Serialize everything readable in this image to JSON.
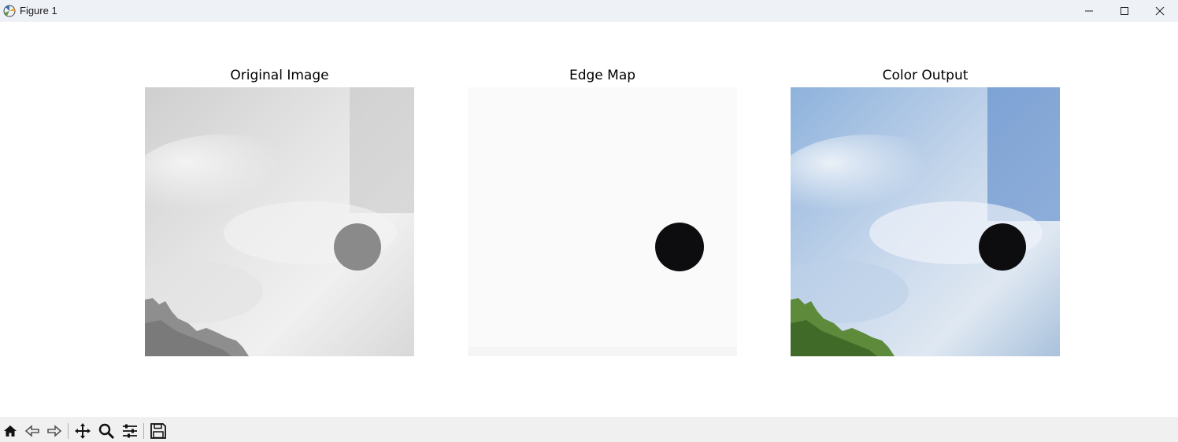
{
  "window": {
    "title": "Figure 1"
  },
  "figure": {
    "panels": [
      {
        "title": "Original Image"
      },
      {
        "title": "Edge Map"
      },
      {
        "title": "Color Output"
      }
    ]
  },
  "toolbar": {
    "buttons": [
      "home-icon",
      "back-icon",
      "forward-icon",
      "pan-icon",
      "zoom-icon",
      "configure-subplots-icon",
      "save-icon"
    ]
  },
  "colors": {
    "titlebar_bg": "#eef2f7",
    "toolbar_bg": "#f0f0f0",
    "sky_blue": "#4a7ec4",
    "grey_circle": "#8a8a8a",
    "dark_circle": "#0d0d10"
  }
}
